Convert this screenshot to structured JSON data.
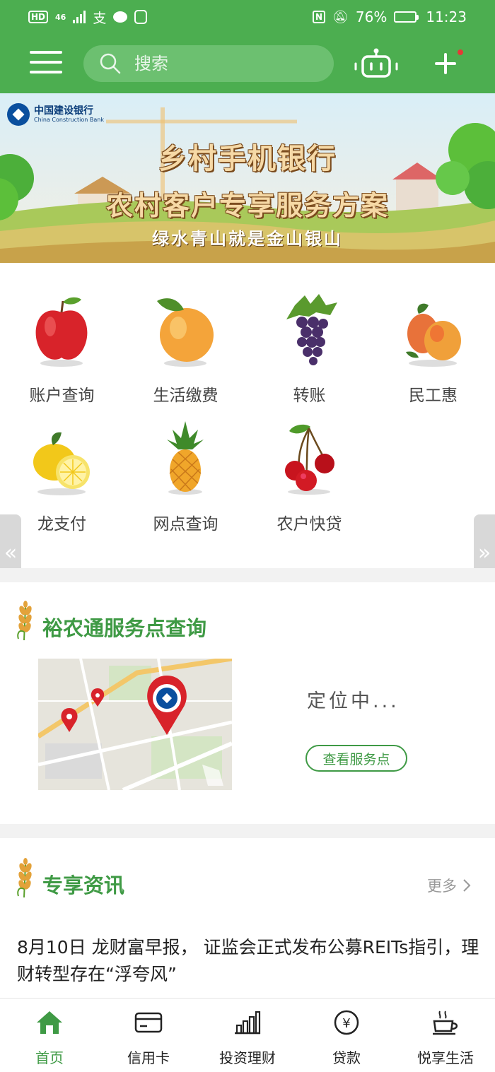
{
  "status_bar": {
    "left_badges": [
      "HD",
      "46"
    ],
    "battery": "76%",
    "time": "11:23",
    "battery_level": 0.76
  },
  "header": {
    "search_placeholder": "搜索",
    "icons": [
      "menu-icon",
      "search-icon",
      "robot-icon",
      "plus-icon"
    ],
    "accent_color": "#4cae50"
  },
  "banner": {
    "bank_name_cn": "中国建设银行",
    "bank_name_en": "China Construction Bank",
    "title1": "乡村手机银行",
    "title2": "农村客户专享服务方案",
    "subtitle": "绿水青山就是金山银山"
  },
  "services": [
    {
      "label": "账户查询",
      "icon": "apple-icon"
    },
    {
      "label": "生活缴费",
      "icon": "apricot-icon"
    },
    {
      "label": "转账",
      "icon": "grapes-icon"
    },
    {
      "label": "民工惠",
      "icon": "mango-icon"
    },
    {
      "label": "龙支付",
      "icon": "lemon-icon"
    },
    {
      "label": "网点查询",
      "icon": "pineapple-icon"
    },
    {
      "label": "农户快贷",
      "icon": "cherry-icon"
    }
  ],
  "side_tabs": {
    "left": "«",
    "right": "»"
  },
  "service_points": {
    "title": "裕农通服务点查询",
    "status": "定位中...",
    "button": "查看服务点"
  },
  "news": {
    "title": "专享资讯",
    "more": "更多",
    "headline": "8月10日 龙财富早报， 证监会正式发布公募REITs指引，理财转型存在“浮夸风”"
  },
  "bottom_nav": [
    {
      "label": "首页",
      "icon": "home-icon",
      "active": true
    },
    {
      "label": "信用卡",
      "icon": "credit-card-icon",
      "active": false
    },
    {
      "label": "投资理财",
      "icon": "bar-chart-icon",
      "active": false
    },
    {
      "label": "贷款",
      "icon": "yuan-coin-icon",
      "active": false
    },
    {
      "label": "悦享生活",
      "icon": "coffee-cup-icon",
      "active": false
    }
  ]
}
